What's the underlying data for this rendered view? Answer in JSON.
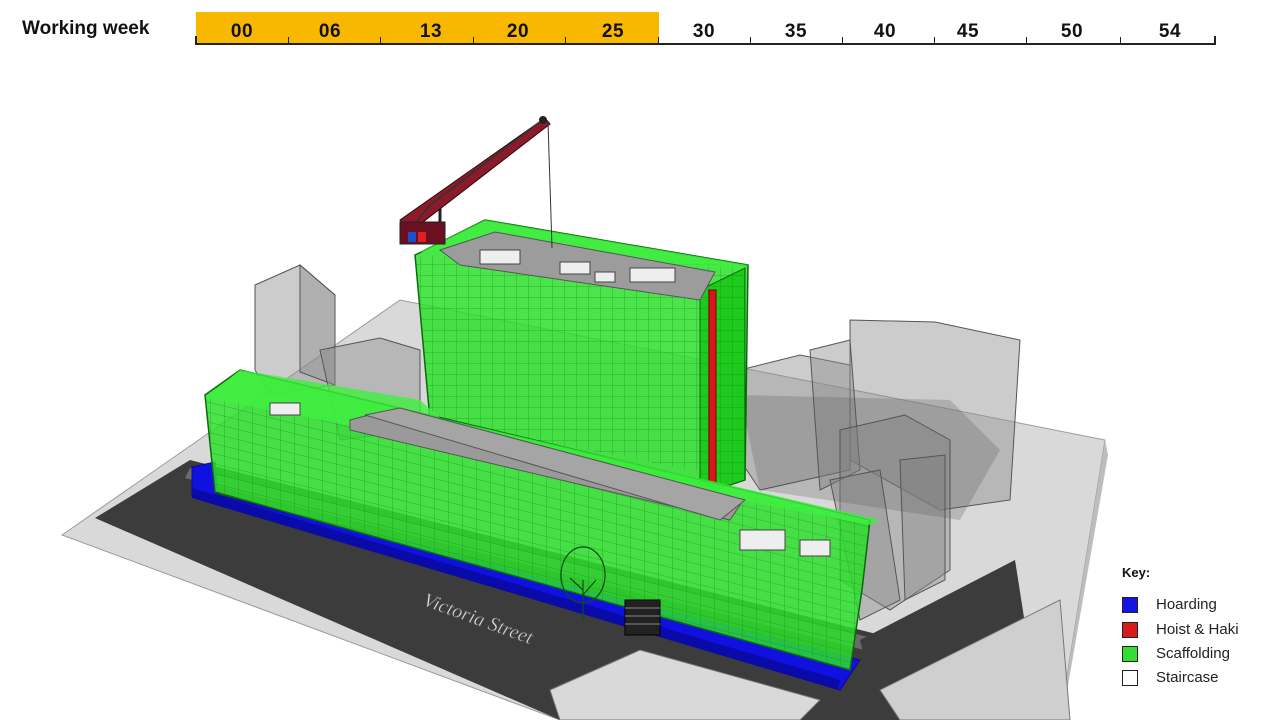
{
  "timeline": {
    "title": "Working week",
    "highlight_color": "#f9b800",
    "weeks": [
      "00",
      "06",
      "13",
      "20",
      "25",
      "30",
      "35",
      "40",
      "45",
      "50",
      "54"
    ],
    "completed_through": "25"
  },
  "scene": {
    "street_label": "Victoria Street",
    "colors": {
      "hoarding": "#1010e0",
      "hoist": "#d81818",
      "scaffolding": "#22dd22",
      "context_buildings": "#8a8a8a",
      "road": "#3a3a3a",
      "ground": "#d6d6d6"
    },
    "icons": [
      "crane-icon",
      "tree-icon",
      "staircase-icon"
    ]
  },
  "key": {
    "title": "Key:",
    "items": [
      {
        "label": "Hoarding",
        "color": "#1414e6"
      },
      {
        "label": "Hoist & Haki",
        "color": "#d41c1c"
      },
      {
        "label": "Scaffolding",
        "color": "#33dd33"
      },
      {
        "label": "Staircase",
        "color": "#ffffff"
      }
    ]
  }
}
